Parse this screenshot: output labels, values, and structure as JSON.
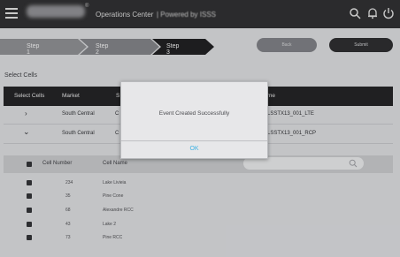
{
  "header": {
    "brand_mark": "®",
    "app_title": "Operations Center",
    "powered_by": "| Powered by ISSS",
    "icons": [
      "hamburger-icon",
      "search-icon",
      "bell-icon",
      "power-icon"
    ]
  },
  "wizard": {
    "steps": [
      "Step 1",
      "Step 2",
      "Step 3"
    ],
    "active_step": 3,
    "back_label": "Back",
    "submit_label": "Submit"
  },
  "section_label": "Select Cells",
  "markets_table": {
    "columns": [
      "Select Cells",
      "Market",
      "S",
      "me"
    ],
    "rows": [
      {
        "expander": "›",
        "market": "South Central",
        "c": "C",
        "name": "LSSTX13_001_LTE"
      },
      {
        "expander": "⌄",
        "market": "South Central",
        "c": "C",
        "name": "LSSTX13_001_RCP"
      }
    ]
  },
  "cells_table": {
    "columns": [
      "Cell Number",
      "Cell Name"
    ],
    "rows": [
      {
        "number": "234",
        "name": "Lake Livieia"
      },
      {
        "number": "35",
        "name": "Pine Cone"
      },
      {
        "number": "68",
        "name": "Alexandre RCC"
      },
      {
        "number": "43",
        "name": "Lake 2"
      },
      {
        "number": "73",
        "name": "Pine RCC"
      }
    ]
  },
  "modal": {
    "message": "Event Created Successfully",
    "ok_label": "OK"
  },
  "colors": {
    "accent": "#3fb2e4",
    "header_bg": "#2c2c2e",
    "table_header_bg": "#1f1f22"
  }
}
